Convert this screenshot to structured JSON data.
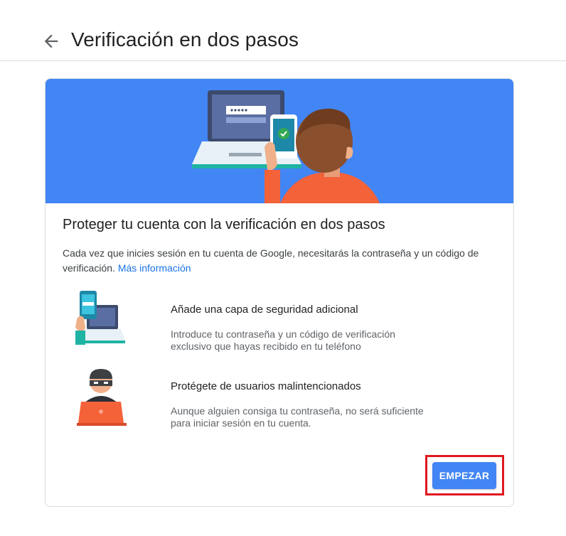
{
  "header": {
    "back_icon": "arrow-left-icon",
    "title": "Verificación en dos pasos"
  },
  "card": {
    "banner_color": "#4285f4",
    "banner_illustration": "laptop-phone-person-illustration",
    "title": "Proteger tu cuenta con la verificación en dos pasos",
    "description": "Cada vez que inicies sesión en tu cuenta de Google, necesitarás la contraseña y un código de verificación.",
    "learn_more": "Más información",
    "features": [
      {
        "icon": "phone-laptop-icon",
        "title": "Añade una capa de seguridad adicional",
        "description": "Introduce tu contraseña y un código de verificación exclusivo que hayas recibido en tu teléfono"
      },
      {
        "icon": "masked-intruder-icon",
        "title": "Protégete de usuarios malintencionados",
        "description": "Aunque alguien consiga tu contraseña, no será suficiente para iniciar sesión en tu cuenta."
      }
    ],
    "start_button": "EMPEZAR"
  },
  "colors": {
    "accent": "#4285f4",
    "link": "#1a73e8",
    "highlight_box": "#e0181f"
  }
}
